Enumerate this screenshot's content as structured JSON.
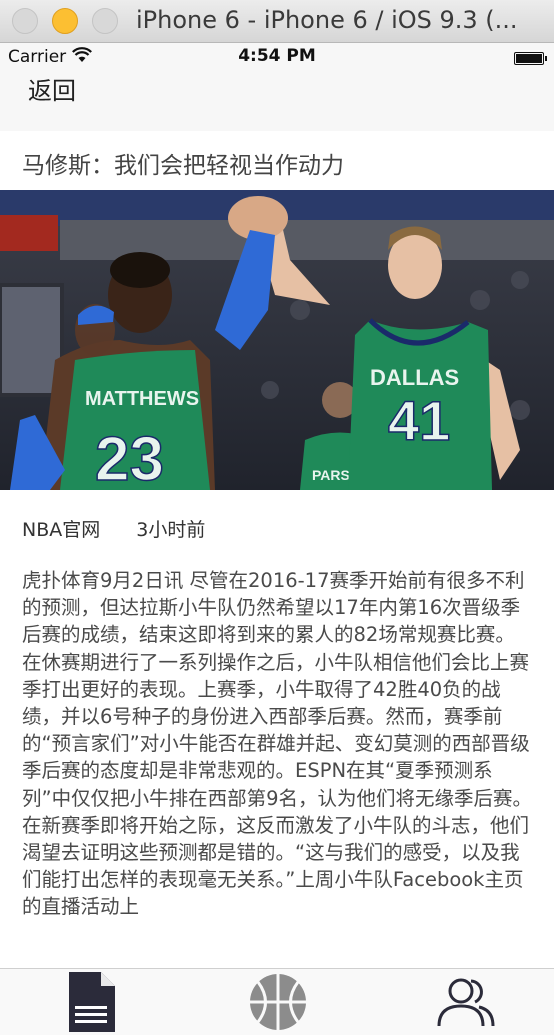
{
  "window": {
    "title": "iPhone 6 - iPhone 6 / iOS 9.3 (..."
  },
  "status_bar": {
    "carrier": "Carrier",
    "time": "4:54 PM"
  },
  "nav": {
    "back_label": "返回"
  },
  "article": {
    "headline": "马修斯：我们会把轻视当作动力",
    "source": "NBA官网",
    "time_ago": "3小时前",
    "photo_jerseys": {
      "left_name": "MATTHEWS",
      "left_number": "23",
      "right_team": "DALLAS",
      "right_number": "41",
      "back_name": "PARSO"
    },
    "body": "虎扑体育9月2日讯 尽管在2016-17赛季开始前有很多不利的预测，但达拉斯小牛队仍然希望以17年内第16次晋级季后赛的成绩，结束这即将到来的累人的82场常规赛比赛。在休赛期进行了一系列操作之后，小牛队相信他们会比上赛季打出更好的表现。上赛季，小牛取得了42胜40负的战绩，并以6号种子的身份进入西部季后赛。然而，赛季前的“预言家们”对小牛能否在群雄并起、变幻莫测的西部晋级季后赛的态度却是非常悲观的。ESPN在其“夏季预测系列”中仅仅把小牛排在西部第9名，认为他们将无缘季后赛。在新赛季即将开始之际，这反而激发了小牛队的斗志，他们渴望去证明这些预测都是错的。“这与我们的感受，以及我们能打出怎样的表现毫无关系。”上周小牛队Facebook主页的直播活动上"
  },
  "tabbar": {
    "tabs": [
      {
        "icon": "document-icon"
      },
      {
        "icon": "basketball-icon"
      },
      {
        "icon": "people-icon"
      }
    ]
  }
}
